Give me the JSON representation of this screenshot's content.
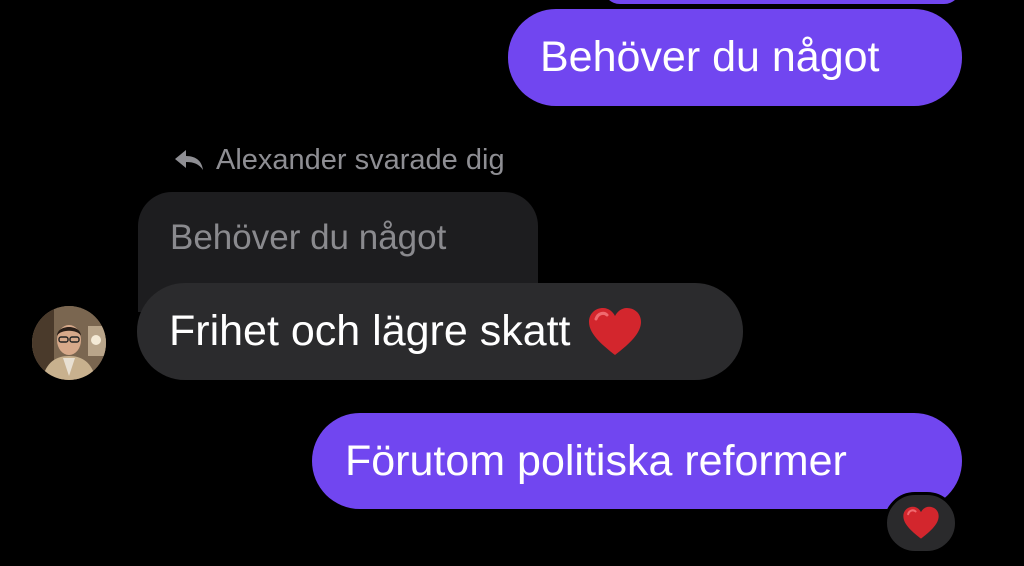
{
  "messages": {
    "outgoing_1": "Behöver du något",
    "reply_indicator": "Alexander svarade dig",
    "quoted_text": "Behöver du något",
    "incoming_1": "Frihet och lägre skatt",
    "outgoing_2": "Förutom politiska reformer"
  },
  "icons": {
    "reply": "reply-arrow-icon",
    "heart": "red-heart-icon"
  },
  "colors": {
    "background": "#000000",
    "outgoing_bubble": "#7146f0",
    "incoming_bubble": "#2b2b2d",
    "quoted_bubble": "#1d1d1f",
    "heart": "#d3262d"
  }
}
